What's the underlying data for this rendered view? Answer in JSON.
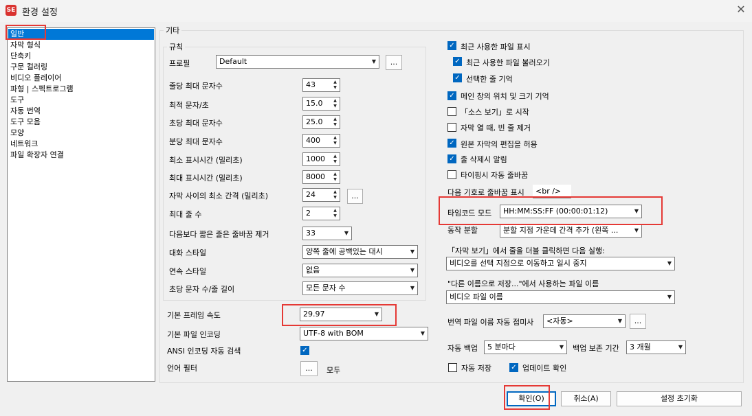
{
  "window": {
    "title": "환경 설정",
    "app_icon_text": "SE"
  },
  "sidebar": {
    "items": [
      "일반",
      "자막 형식",
      "단축키",
      "구문 컬러링",
      "비디오 플레이어",
      "파형 | 스펙트로그램",
      "도구",
      "자동 번역",
      "도구 모음",
      "모양",
      "네트워크",
      "파일 확장자 연결"
    ]
  },
  "misc": {
    "title": "기타",
    "rules": {
      "title": "규칙",
      "profile_label": "프로필",
      "profile_value": "Default",
      "max_chars_line_label": "줄당 최대 문자수",
      "max_chars_line": "43",
      "optimal_cps_label": "최적 문자/초",
      "optimal_cps": "15.0",
      "max_cps_label": "초당 최대 문자수",
      "max_cps": "25.0",
      "max_cpm_label": "분당 최대 문자수",
      "max_cpm": "400",
      "min_duration_label": "최소 표시시간 (밀리초)",
      "min_duration": "1000",
      "max_duration_label": "최대 표시시간 (밀리초)",
      "max_duration": "8000",
      "min_gap_label": "자막 사이의 최소 간격 (밀리초)",
      "min_gap": "24",
      "max_lines_label": "최대 줄 수",
      "max_lines": "2",
      "unbreak_label": "다음보다 짧은 줄은 줄바꿈 제거",
      "unbreak_value": "33",
      "dialog_style_label": "대화 스타일",
      "dialog_style_value": "양쪽 줄에 공백있는 대시",
      "continuation_label": "연속 스타일",
      "continuation_value": "없음",
      "cps_line_length_label": "초당 문자 수/줄 길이",
      "cps_line_length_value": "모든 문자 수",
      "ellipsis": "..."
    },
    "frame_rate_label": "기본 프레임 속도",
    "frame_rate_value": "29.97",
    "encoding_label": "기본 파일 인코딩",
    "encoding_value": "UTF-8 with BOM",
    "ansi_label": "ANSI 인코딩 자동 검색",
    "language_filter_label": "언어 필터",
    "language_filter_value": "모두"
  },
  "right": {
    "show_recent": "최근 사용한 파일 표시",
    "load_recent": "최근 사용한 파일 불러오기",
    "remember_line": "선택한 줄 기억",
    "remember_window": "메인 창의 위치 및 크기 기억",
    "start_source": "「소스 보기」로 시작",
    "remove_blank": "자막 열 때, 빈 줄 제거",
    "allow_edit": "원본 자막의 편집을 허용",
    "prompt_delete": "줄 삭제시 알림",
    "auto_break": "타이핑시 자동 줄바꿈",
    "break_symbol_label": "다음 기호로 줄바꿈 표시",
    "break_symbol_value": "<br />",
    "timecode_label": "타임코드 모드",
    "timecode_value": "HH:MM:SS:FF (00:00:01:12)",
    "split_label": "동작 분할",
    "split_value": "분할 지점 가운데 간격 추가 (왼쪽 ...",
    "dblclick_label": "「자막 보기」에서 줄을 더블 클릭하면 다음 실행:",
    "dblclick_value": "비디오를 선택 지점으로 이동하고 일시 중지",
    "saveas_label": "\"다른 이름으로 저장...\"에서 사용하는 파일 이름",
    "saveas_value": "비디오 파일 이름",
    "suffix_label": "번역 파일 이름 자동 접미사",
    "suffix_value": "<자동>",
    "backup_label": "자동 백업",
    "backup_value": "5 분마다",
    "keep_label": "백업 보존 기간",
    "keep_value": "3 개월",
    "autosave": "자동 저장",
    "check_updates": "업데이트 확인"
  },
  "buttons": {
    "ok": "확인(O)",
    "cancel": "취소(A)",
    "reset": "설정 초기화"
  }
}
